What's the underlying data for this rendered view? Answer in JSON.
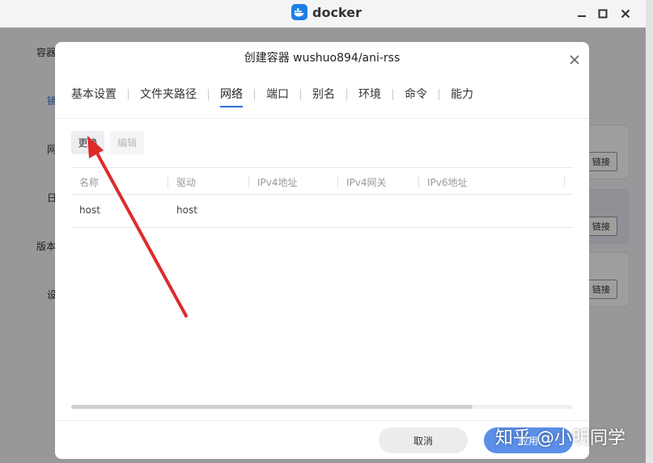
{
  "window": {
    "app_name": "docker",
    "minimize_icon": "minimize-icon",
    "maximize_icon": "maximize-icon",
    "close_icon": "close-icon"
  },
  "background_app": {
    "sidebar_items": [
      "容器",
      "镜",
      "网",
      "日",
      "版本",
      "设"
    ],
    "link_buttons": [
      "链接",
      "链接",
      "链接"
    ]
  },
  "dialog": {
    "title": "创建容器 wushuo894/ani-rss",
    "tabs": [
      {
        "label": "基本设置",
        "active": false
      },
      {
        "label": "文件夹路径",
        "active": false
      },
      {
        "label": "网络",
        "active": true
      },
      {
        "label": "端口",
        "active": false
      },
      {
        "label": "别名",
        "active": false
      },
      {
        "label": "环境",
        "active": false
      },
      {
        "label": "命令",
        "active": false
      },
      {
        "label": "能力",
        "active": false
      }
    ],
    "toolbar": {
      "change_label": "更换",
      "edit_label": "编辑"
    },
    "table": {
      "columns": [
        "名称",
        "驱动",
        "IPv4地址",
        "IPv4网关",
        "IPv6地址"
      ],
      "rows": [
        [
          "host",
          "host",
          "",
          "",
          ""
        ]
      ]
    },
    "horizontal_scroll_fraction": 0.8,
    "footer": {
      "cancel_label": "取消",
      "apply_label": "应用"
    }
  },
  "annotation": {
    "arrow_color": "#e02a2a"
  },
  "watermark": "知乎 @小明同学",
  "colors": {
    "accent": "#2f6fd4",
    "apply_button": "#5b8fe8",
    "docker_icon": "#1d7fe6"
  }
}
